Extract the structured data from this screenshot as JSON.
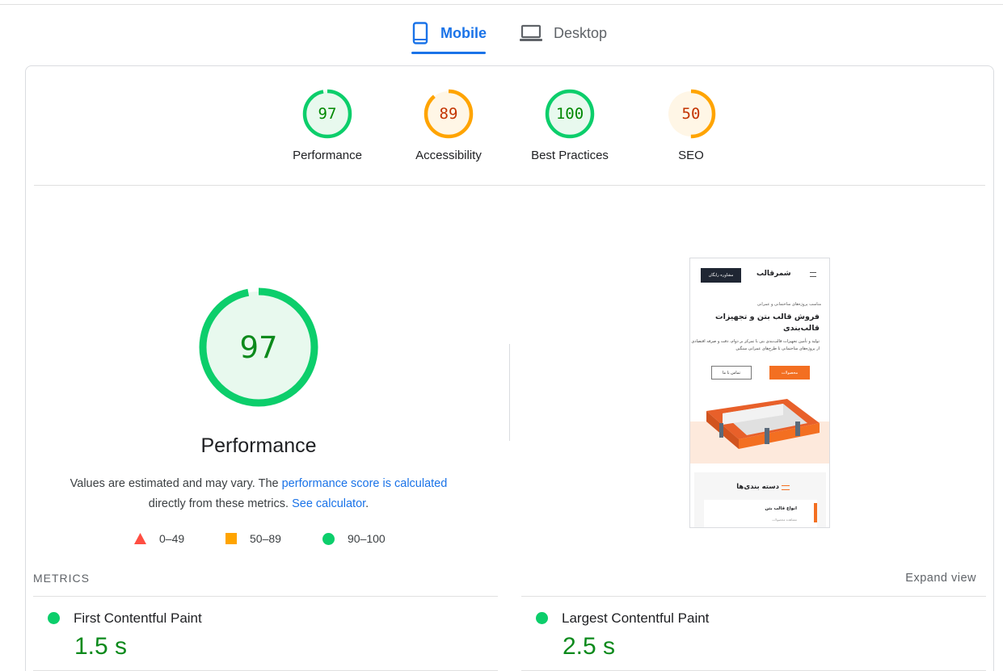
{
  "tabs": {
    "mobile_label": "Mobile",
    "desktop_label": "Desktop"
  },
  "scores": [
    {
      "label": "Performance",
      "value": 97,
      "fraction": 0.97,
      "color": "#0cce6b",
      "bg": "#e8f9ee",
      "text_color": "#008800"
    },
    {
      "label": "Accessibility",
      "value": 89,
      "fraction": 0.89,
      "color": "#ffa400",
      "bg": "#fff6e6",
      "text_color": "#c33300"
    },
    {
      "label": "Best Practices",
      "value": 100,
      "fraction": 1.0,
      "color": "#0cce6b",
      "bg": "#e8f9ee",
      "text_color": "#008800"
    },
    {
      "label": "SEO",
      "value": 50,
      "fraction": 0.5,
      "color": "#ffa400",
      "bg": "#fff6e6",
      "text_color": "#c33300"
    }
  ],
  "main": {
    "score": 97,
    "fraction": 0.97,
    "title": "Performance",
    "desc_prefix": "Values are estimated and may vary. The ",
    "desc_link": "performance score is calculated",
    "desc_middle": "directly from these metrics.",
    "desc_link2": "See calculator",
    "desc_suffix": "."
  },
  "legend": {
    "fail": "0–49",
    "average": "50–89",
    "pass": "90–100"
  },
  "colors": {
    "accent": "#1a73e8",
    "pass": "#0cce6b",
    "average": "#ffa400",
    "fail": "#ff4e42",
    "pass_text": "#0c8a1c"
  },
  "screenshot": {
    "consult_button": "مشاوره رایگان",
    "logo": "شمرقالب",
    "tagline": "مناسب پروژه‌های ساختمانی و عمرانی",
    "headline": "فروش قالب بتن و تجهیزات قالب‌بندی",
    "paragraph": "تولید و تأمین تجهیزات قالب‌بندی بتن با تمرکز بر دوام، دقت و صرفه اقتصادی از پروژه‌های ساختمانی تا طرح‌های عمرانی سنگین",
    "products_button": "محصولات",
    "contact_button": "تماس با ما",
    "categories_title": "دسته بندی‌ها",
    "category_card_title": "انواع قالب بتن",
    "category_card_sub": "مشاهده محصولات"
  },
  "metrics": {
    "title": "METRICS",
    "expand_label": "Expand view",
    "items": [
      {
        "name": "First Contentful Paint",
        "value": "1.5 s"
      },
      {
        "name": "Largest Contentful Paint",
        "value": "2.5 s"
      }
    ]
  }
}
